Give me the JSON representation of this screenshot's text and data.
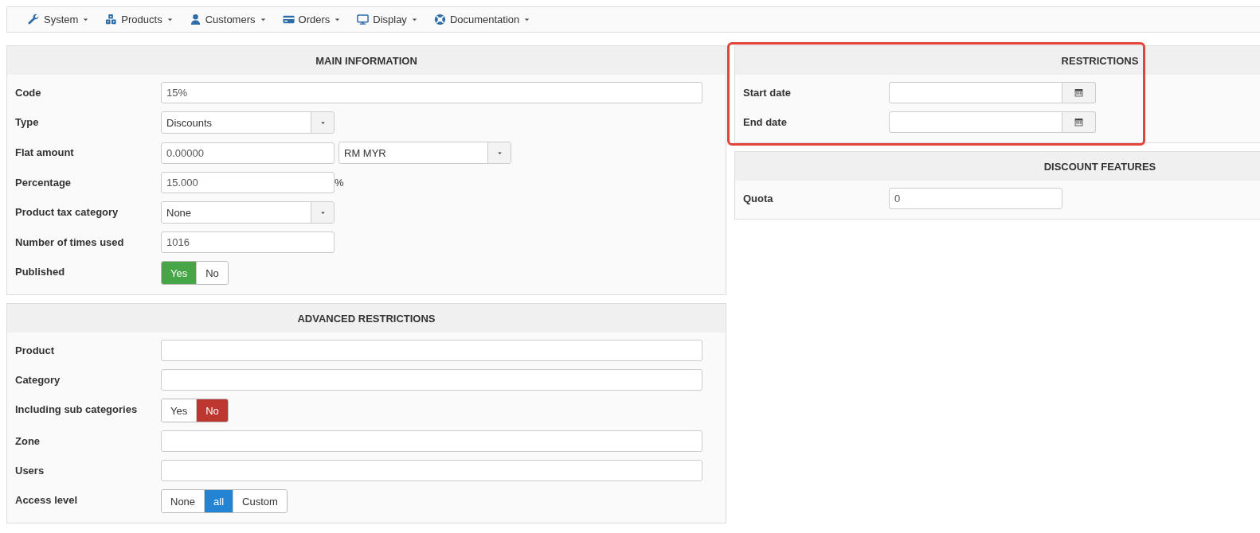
{
  "menu": [
    {
      "label": "System"
    },
    {
      "label": "Products"
    },
    {
      "label": "Customers"
    },
    {
      "label": "Orders"
    },
    {
      "label": "Display"
    },
    {
      "label": "Documentation"
    }
  ],
  "columns": [
    {
      "panels": [
        {
          "title": "MAIN INFORMATION",
          "highlighted": false,
          "fields": [
            {
              "kind": "text",
              "label": "Code",
              "value": "15%"
            },
            {
              "kind": "select",
              "label": "Type",
              "value": "Discounts"
            },
            {
              "kind": "amount",
              "label": "Flat amount",
              "value": "0.00000",
              "currency": "RM MYR"
            },
            {
              "kind": "number",
              "label": "Percentage",
              "value": "15.000",
              "suffix": "%"
            },
            {
              "kind": "select",
              "label": "Product tax category",
              "value": "None"
            },
            {
              "kind": "number",
              "label": "Number of times used",
              "value": "1016"
            },
            {
              "kind": "yesno",
              "label": "Published",
              "options": [
                {
                  "label": "Yes",
                  "selected": true
                },
                {
                  "label": "No",
                  "selected": false
                }
              ]
            }
          ]
        },
        {
          "title": "ADVANCED RESTRICTIONS",
          "highlighted": false,
          "fields": [
            {
              "kind": "text",
              "label": "Product"
            },
            {
              "kind": "text",
              "label": "Category"
            },
            {
              "kind": "yesno",
              "label": "Including sub categories",
              "options": [
                {
                  "label": "Yes",
                  "selected": false
                },
                {
                  "label": "No",
                  "selected": true
                }
              ]
            },
            {
              "kind": "text",
              "label": "Zone"
            },
            {
              "kind": "text",
              "label": "Users"
            },
            {
              "kind": "choice",
              "label": "Access level",
              "options": [
                {
                  "label": "None",
                  "selected": false
                },
                {
                  "label": "all",
                  "selected": true
                },
                {
                  "label": "Custom",
                  "selected": false
                }
              ]
            }
          ]
        }
      ]
    },
    {
      "panels": [
        {
          "title": "RESTRICTIONS",
          "highlighted": true,
          "fields": [
            {
              "kind": "date",
              "label": "Start date"
            },
            {
              "kind": "date",
              "label": "End date"
            }
          ]
        },
        {
          "title": "DISCOUNT FEATURES",
          "highlighted": false,
          "fields": [
            {
              "kind": "number",
              "label": "Quota",
              "value": "0"
            }
          ]
        }
      ]
    }
  ]
}
